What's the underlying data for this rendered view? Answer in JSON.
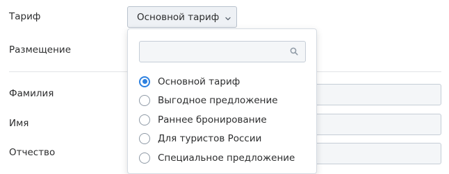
{
  "form": {
    "tariff_label": "Тариф",
    "placement_label": "Размещение",
    "lastname_label": "Фамилия",
    "firstname_label": "Имя",
    "patronymic_label": "Отчество",
    "lastname_value": "",
    "firstname_value": "",
    "patronymic_value": ""
  },
  "tariff_select": {
    "selected": "Основной тариф",
    "icon": "chevron-down-icon"
  },
  "dropdown": {
    "search_value": "",
    "search_icon": "search-icon",
    "options": [
      {
        "label": "Основной тариф",
        "checked": true
      },
      {
        "label": "Выгодное предложение",
        "checked": false
      },
      {
        "label": "Раннее бронирование",
        "checked": false
      },
      {
        "label": "Для туристов России",
        "checked": false
      },
      {
        "label": "Специальное предложение",
        "checked": false
      }
    ]
  },
  "colors": {
    "accent": "#2d81e0",
    "text": "#2c2d2e",
    "border": "#c5cdd6"
  }
}
